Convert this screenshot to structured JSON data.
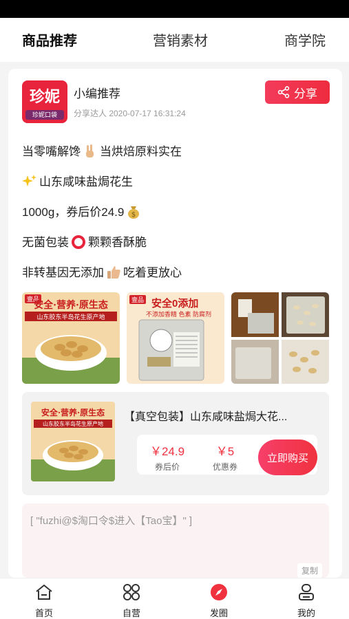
{
  "tabs": [
    {
      "label": "商品推荐",
      "active": true
    },
    {
      "label": "营销素材",
      "active": false
    },
    {
      "label": "商学院",
      "active": false
    }
  ],
  "post": {
    "avatar_text": "珍妮",
    "avatar_sub": "珍妮口袋",
    "author": "小编推荐",
    "meta": "分享达人 2020-07-17 16:31:24",
    "share_label": "分享",
    "lines": [
      {
        "before": "当零嘴解馋",
        "emoji": "victory-hand-icon",
        "after": "当烘焙原料实在"
      },
      {
        "before": "",
        "emoji": "sparkles-icon",
        "after": "山东咸味盐焗花生"
      },
      {
        "before": "1000g，券后价24.9",
        "emoji": "money-bag-icon",
        "after": ""
      },
      {
        "before": "无菌包装",
        "emoji": "red-circle-icon",
        "after": "颗颗香酥脆"
      },
      {
        "before": "非转基因无添加",
        "emoji": "thumbs-up-icon",
        "after": "吃着更放心"
      }
    ],
    "images": {
      "img1": {
        "brand": "壹品",
        "slogan": "安全·营养·原生态",
        "banner": "山东胶东半岛花生原产地"
      },
      "img2": {
        "brand": "壹品",
        "title": "安全0添加",
        "subtitle": "不添加香精 色素 防腐剂"
      }
    }
  },
  "product": {
    "title": "【真空包装】山东咸味盐焗大花...",
    "price": "￥24.9",
    "price_label": "券后价",
    "coupon": "￥5",
    "coupon_label": "优惠券",
    "buy_label": "立即购买"
  },
  "command": {
    "text": "[ \"fuzhi@$淘口令$进入【Tao宝】\" ]",
    "copy_label": "复制"
  },
  "nav": [
    {
      "label": "首页",
      "icon": "home-icon",
      "active": false
    },
    {
      "label": "自营",
      "icon": "grid-icon",
      "active": false
    },
    {
      "label": "发圈",
      "icon": "compass-icon",
      "active": true
    },
    {
      "label": "我的",
      "icon": "user-icon",
      "active": false
    }
  ],
  "colors": {
    "accent": "#f0323f",
    "avatar_bg": "#e8233c"
  }
}
